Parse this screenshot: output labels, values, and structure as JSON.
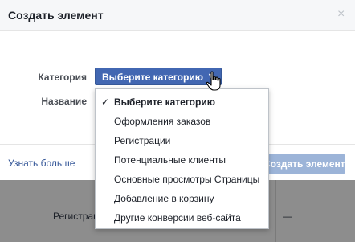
{
  "dialog": {
    "title": "Создать элемент",
    "close_symbol": "×"
  },
  "form": {
    "category_label": "Категория",
    "name_label": "Название",
    "category_selected": "Выберите категорию",
    "name_value": ""
  },
  "dropdown": {
    "items": [
      "Выберите категорию",
      "Оформления заказов",
      "Регистрации",
      "Потенциальные клиенты",
      "Основные просмотры Страницы",
      "Добавление в корзину",
      "Другие конверсии веб-сайта"
    ],
    "check_symbol": "✓"
  },
  "footer": {
    "learn_more": "Узнать больше",
    "create_button": "Создать элемент"
  },
  "background_table": {
    "cell_text": "Регистрации",
    "dash": "—"
  },
  "colors": {
    "accent": "#4267b2",
    "link": "#365899",
    "disabled_button": "#9cb4d8"
  }
}
